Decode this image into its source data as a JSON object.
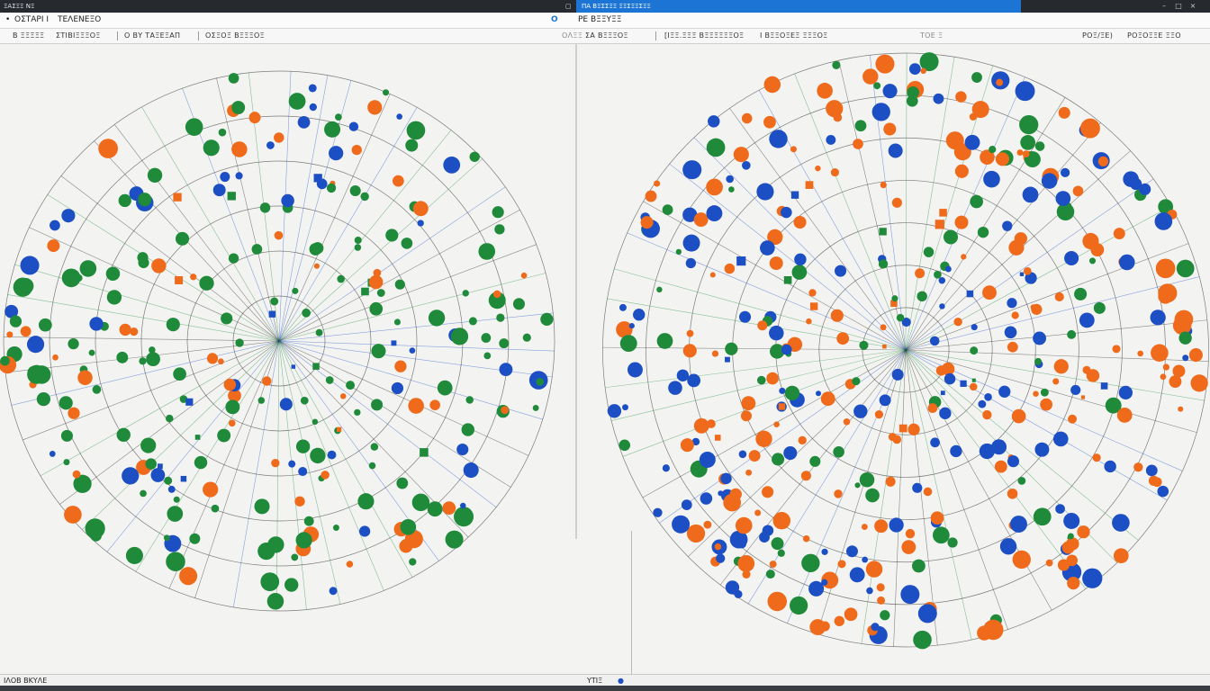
{
  "window": {
    "app_label": "ΞΑΣΞΞ ΝΞ",
    "active_tab_label": "ΠΑ ΒΞΣΣΞΞ ΞΞΣΞΞΣΞΞ"
  },
  "topbar": {
    "item1": "ΟΣΤΑΡΙ Ι",
    "item2": "ΤΕΛΕΝΕΞΟ",
    "logo": "Ο",
    "item3": "ΡΕ  ΒΞΞΥΞΞ"
  },
  "toolbar": {
    "left_items": [
      "Β ΞΞΞΞΞ",
      "ΣΤΙΒΙΞΞΞΟΞ",
      "Ο ΒΥ ΤΑΞΕΞΑΠ",
      "ΟΣΞΟΞ ΒΞΞΞΟΞ"
    ],
    "right_items": [
      "ΟΛΞΞ",
      "ΣΑ ΒΞΞΞΟΞ",
      "[ΙΞΞ.ΞΞΞ ΒΞΞΞΞΞΞΟΞ",
      "Ι ΒΞΞΟΞΕΞ ΞΞΞΟΞ",
      "ΤΟΕ Ξ",
      "ΡΟΞ/ΞΕ)",
      "ΡΟΞΟΞΞΕ ΞΞΟ"
    ]
  },
  "status": {
    "left": "ΙΛΟΒ ΒΚΥΛΕ",
    "right": "ΥΤΙΞ"
  },
  "colors": {
    "green": "#1f8a3a",
    "blue": "#1d4fc4",
    "orange": "#ef6a1a",
    "wire": "#1c1c1c"
  },
  "graphs": [
    {
      "name": "left-network",
      "dominant_palette": [
        "green",
        "green",
        "green",
        "blue",
        "orange"
      ],
      "rings": 6
    },
    {
      "name": "right-network",
      "dominant_palette": [
        "blue",
        "blue",
        "orange",
        "green",
        "orange"
      ],
      "rings": 7
    }
  ]
}
